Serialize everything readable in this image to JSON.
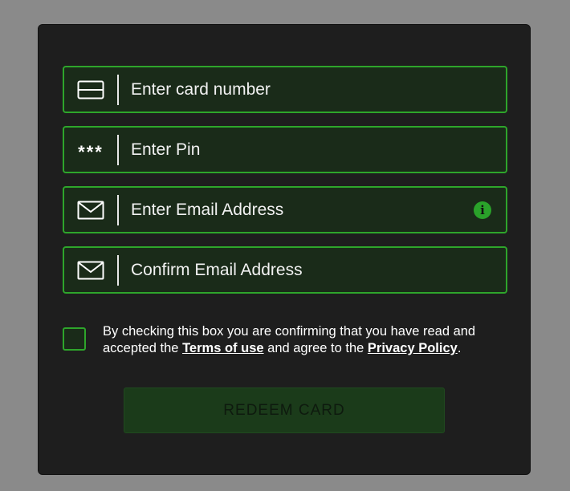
{
  "form": {
    "fields": [
      {
        "icon": "credit-card-icon",
        "placeholder": "Enter card number",
        "value": ""
      },
      {
        "icon": "pin-asterisks-icon",
        "icon_text": "***",
        "placeholder": "Enter Pin",
        "value": ""
      },
      {
        "icon": "envelope-icon",
        "placeholder": "Enter Email Address",
        "value": "",
        "trailing_icon": "info-icon"
      },
      {
        "icon": "envelope-icon",
        "placeholder": "Confirm Email Address",
        "value": ""
      }
    ],
    "consent": {
      "checked": false,
      "text_before": "By checking this box you are confirming that you have read and accepted the ",
      "terms_link": "Terms of use",
      "text_middle": " and agree to the ",
      "privacy_link": "Privacy Policy",
      "text_after": "."
    },
    "redeem_label": "REDEEM CARD",
    "info_glyph": "i"
  },
  "colors": {
    "accent": "#2ea52b",
    "panel_bg": "#1e1e1e",
    "field_bg": "#1a2b19",
    "button_bg": "#1b3b1a",
    "page_bg": "#8a8a8a"
  }
}
